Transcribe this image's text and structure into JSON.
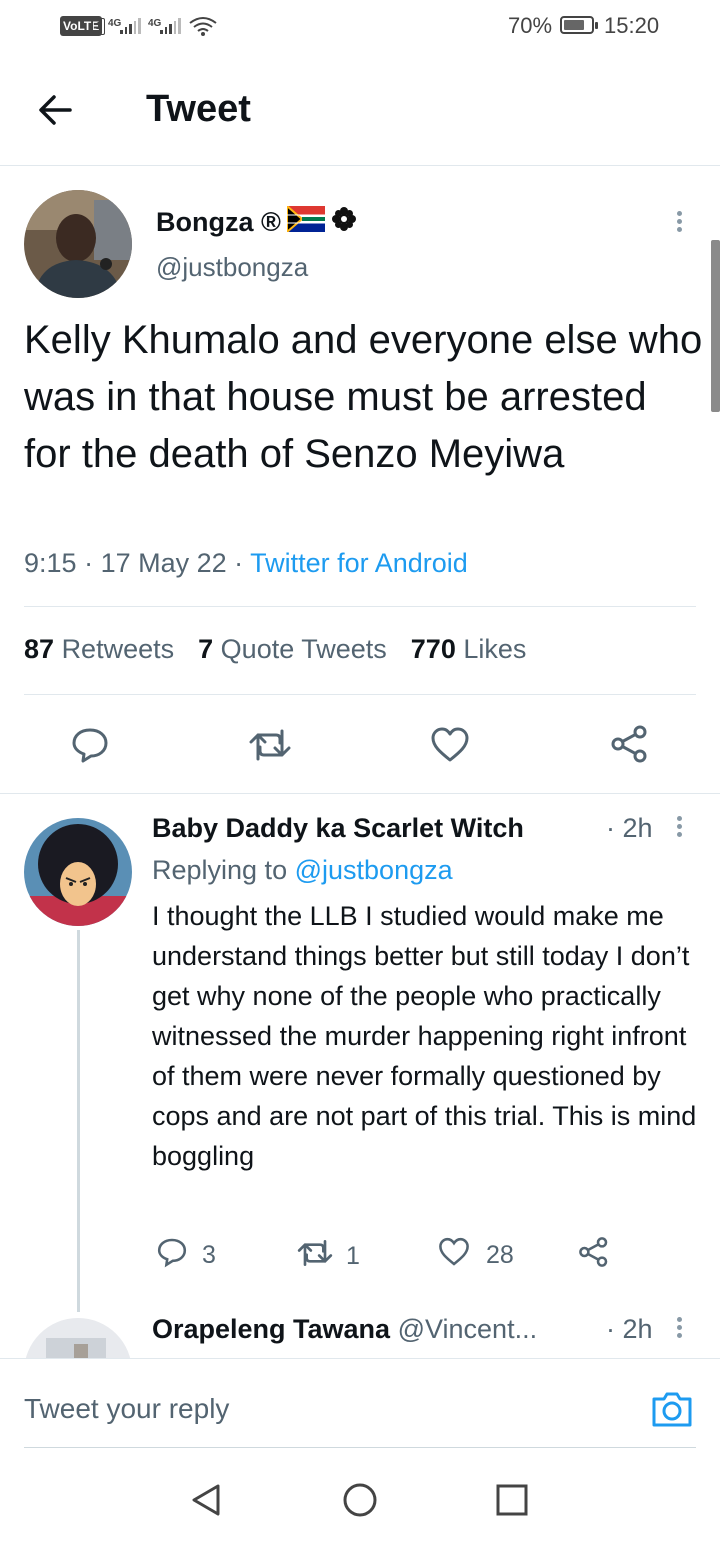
{
  "status_bar": {
    "volte": "VoLTE",
    "sim": "1",
    "net1": "4G",
    "net2": "4G",
    "battery_pct": "70%",
    "battery_level": 0.7,
    "time": "15:20"
  },
  "header": {
    "title": "Tweet",
    "back_icon": "arrow-left-icon"
  },
  "tweet": {
    "author_name": "Bongza ®",
    "author_handle": "@justbongza",
    "text": "Kelly Khumalo and everyone else who was in that house must be arrested for the death of Senzo Meyiwa",
    "time": "9:15",
    "date": "17 May 22",
    "source": "Twitter for Android",
    "retweets_count": "87",
    "retweets_label": "Retweets",
    "quotes_count": "7",
    "quotes_label": "Quote Tweets",
    "likes_count": "770",
    "likes_label": "Likes",
    "actions": [
      "reply-icon",
      "retweet-icon",
      "like-icon",
      "share-icon"
    ]
  },
  "replies": [
    {
      "name": "Baby Daddy ka Scarlet Witch",
      "time": "· 2h",
      "replying_prefix": "Replying to",
      "replying_handle": "@justbongza",
      "text": "I thought the LLB I studied would make me understand things better but still today I don’t get why none of the people who practically witnessed the murder happening right infront of them were never formally questioned by cops and are not part of this trial. This is mind boggling",
      "reply_count": "3",
      "retweet_count": "1",
      "like_count": "28"
    },
    {
      "name": "Orapeleng Tawana",
      "handle": "@Vincent...",
      "time": "· 2h"
    }
  ],
  "composer": {
    "placeholder": "Tweet your reply",
    "camera_icon": "camera-icon"
  },
  "nav": [
    "back-triangle-icon",
    "home-circle-icon",
    "recents-square-icon"
  ],
  "colors": {
    "link": "#1d9bf0",
    "muted": "#536471",
    "divider": "#e1e8ed"
  }
}
